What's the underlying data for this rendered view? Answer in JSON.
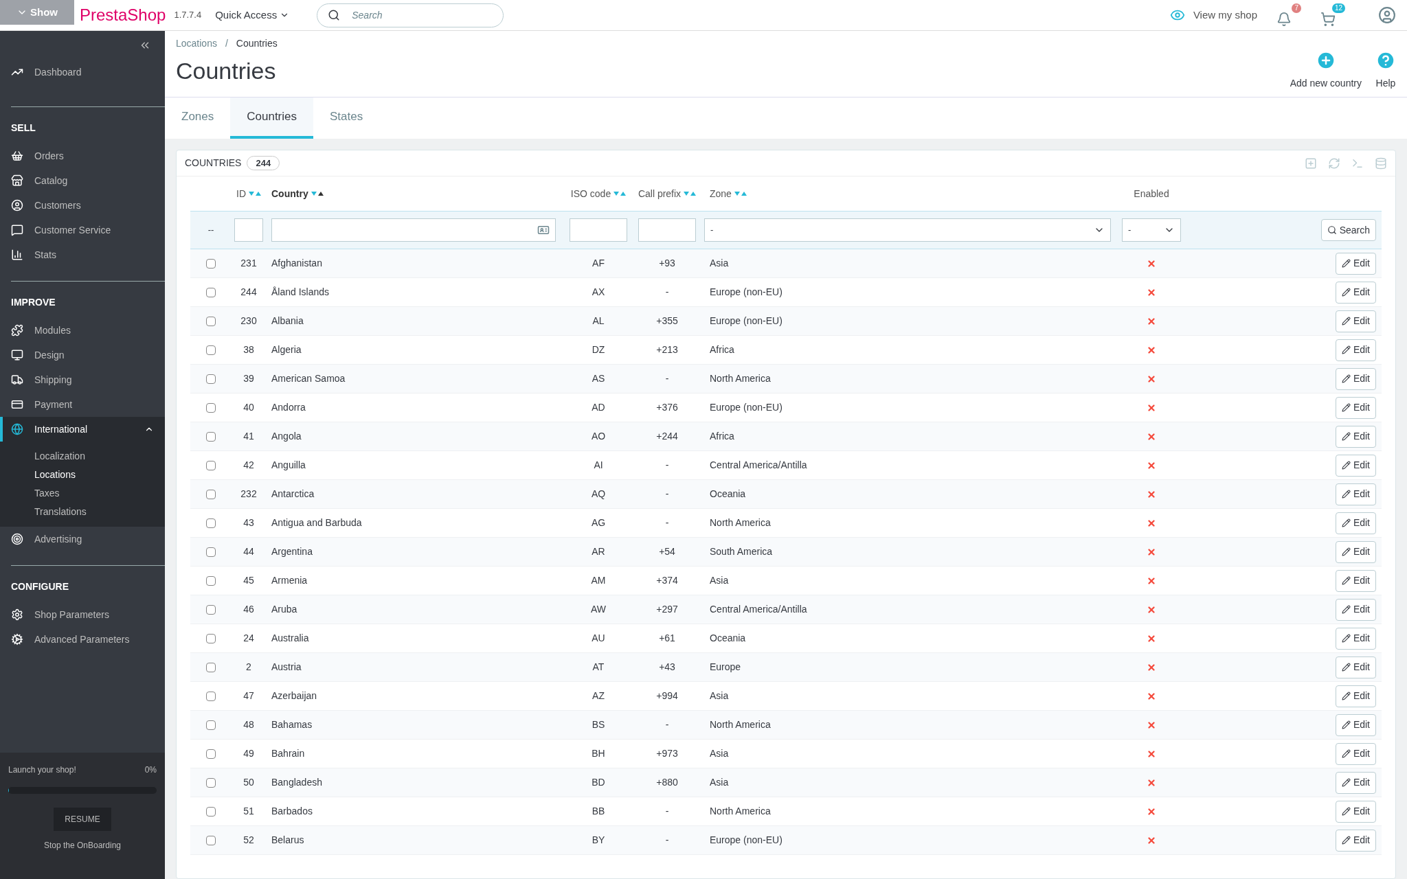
{
  "header": {
    "overlay_button": "Show",
    "logo": "PrestaShop",
    "version": "1.7.7.4",
    "quick_access": "Quick Access",
    "search": {
      "placeholder": "Search"
    },
    "view_shop": "View my shop",
    "notifications": [
      {
        "kind": "bell",
        "count": "7",
        "color": "#e08080"
      },
      {
        "kind": "cart",
        "count": "12",
        "color": "#25b9d7"
      }
    ]
  },
  "sidebar": {
    "sections": [
      {
        "items": [
          {
            "label": "Dashboard",
            "selected": false
          }
        ]
      },
      {
        "title": "SELL",
        "items": [
          {
            "label": "Orders",
            "selected": false
          },
          {
            "label": "Catalog",
            "selected": false
          },
          {
            "label": "Customers",
            "selected": false
          },
          {
            "label": "Customer Service",
            "selected": false
          },
          {
            "label": "Stats",
            "selected": false
          }
        ]
      },
      {
        "title": "IMPROVE",
        "items": [
          {
            "label": "Modules",
            "selected": false
          },
          {
            "label": "Design",
            "selected": false
          },
          {
            "label": "Shipping",
            "selected": false
          },
          {
            "label": "Payment",
            "selected": false
          },
          {
            "label": "International",
            "selected": true,
            "expanded": true,
            "children": [
              {
                "label": "Localization",
                "selected": false
              },
              {
                "label": "Locations",
                "selected": true
              },
              {
                "label": "Taxes",
                "selected": false
              },
              {
                "label": "Translations",
                "selected": false
              }
            ]
          },
          {
            "label": "Advertising",
            "selected": false
          }
        ]
      },
      {
        "title": "CONFIGURE",
        "items": [
          {
            "label": "Shop Parameters",
            "selected": false
          },
          {
            "label": "Advanced Parameters",
            "selected": false
          }
        ]
      }
    ],
    "onboarding": {
      "title": "Launch your shop!",
      "percent": "0%",
      "level": 0,
      "button": "RESUME",
      "stop": "Stop the OnBoarding"
    }
  },
  "breadcrumb": {
    "items": [
      "Locations",
      "Countries"
    ],
    "separator": "/"
  },
  "page_title": "Countries",
  "toolbar": [
    {
      "kind": "add",
      "label": "Add new country"
    },
    {
      "kind": "help",
      "label": "Help"
    }
  ],
  "tabs": [
    {
      "label": "Zones",
      "selected": false
    },
    {
      "label": "Countries",
      "selected": true
    },
    {
      "label": "States",
      "selected": false
    }
  ],
  "panel": {
    "title": "COUNTRIES",
    "count": "244",
    "columns": [
      {
        "label": "ID",
        "sortable": true,
        "sorted": false
      },
      {
        "label": "Country",
        "sortable": true,
        "sorted": true
      },
      {
        "label": "ISO code",
        "sortable": true,
        "sorted": false
      },
      {
        "label": "Call prefix",
        "sortable": true,
        "sorted": false
      },
      {
        "label": "Zone",
        "sortable": true,
        "sorted": false
      },
      {
        "label": "Enabled",
        "sortable": false,
        "sorted": false
      }
    ],
    "filters": {
      "bulk": "--",
      "zone": "-",
      "enabled": "-",
      "search_button": "Search"
    },
    "rows": [
      {
        "id": "231",
        "country": "Afghanistan",
        "iso": "AF",
        "prefix": "+93",
        "zone": "Asia",
        "enabled": false,
        "checked": false,
        "action": "Edit"
      },
      {
        "id": "244",
        "country": "Åland Islands",
        "iso": "AX",
        "prefix": "-",
        "zone": "Europe (non-EU)",
        "enabled": false,
        "checked": false,
        "action": "Edit"
      },
      {
        "id": "230",
        "country": "Albania",
        "iso": "AL",
        "prefix": "+355",
        "zone": "Europe (non-EU)",
        "enabled": false,
        "checked": false,
        "action": "Edit"
      },
      {
        "id": "38",
        "country": "Algeria",
        "iso": "DZ",
        "prefix": "+213",
        "zone": "Africa",
        "enabled": false,
        "checked": false,
        "action": "Edit"
      },
      {
        "id": "39",
        "country": "American Samoa",
        "iso": "AS",
        "prefix": "-",
        "zone": "North America",
        "enabled": false,
        "checked": false,
        "action": "Edit"
      },
      {
        "id": "40",
        "country": "Andorra",
        "iso": "AD",
        "prefix": "+376",
        "zone": "Europe (non-EU)",
        "enabled": false,
        "checked": false,
        "action": "Edit"
      },
      {
        "id": "41",
        "country": "Angola",
        "iso": "AO",
        "prefix": "+244",
        "zone": "Africa",
        "enabled": false,
        "checked": false,
        "action": "Edit"
      },
      {
        "id": "42",
        "country": "Anguilla",
        "iso": "AI",
        "prefix": "-",
        "zone": "Central America/Antilla",
        "enabled": false,
        "checked": false,
        "action": "Edit"
      },
      {
        "id": "232",
        "country": "Antarctica",
        "iso": "AQ",
        "prefix": "-",
        "zone": "Oceania",
        "enabled": false,
        "checked": false,
        "action": "Edit"
      },
      {
        "id": "43",
        "country": "Antigua and Barbuda",
        "iso": "AG",
        "prefix": "-",
        "zone": "North America",
        "enabled": false,
        "checked": false,
        "action": "Edit"
      },
      {
        "id": "44",
        "country": "Argentina",
        "iso": "AR",
        "prefix": "+54",
        "zone": "South America",
        "enabled": false,
        "checked": false,
        "action": "Edit"
      },
      {
        "id": "45",
        "country": "Armenia",
        "iso": "AM",
        "prefix": "+374",
        "zone": "Asia",
        "enabled": false,
        "checked": false,
        "action": "Edit"
      },
      {
        "id": "46",
        "country": "Aruba",
        "iso": "AW",
        "prefix": "+297",
        "zone": "Central America/Antilla",
        "enabled": false,
        "checked": false,
        "action": "Edit"
      },
      {
        "id": "24",
        "country": "Australia",
        "iso": "AU",
        "prefix": "+61",
        "zone": "Oceania",
        "enabled": false,
        "checked": false,
        "action": "Edit"
      },
      {
        "id": "2",
        "country": "Austria",
        "iso": "AT",
        "prefix": "+43",
        "zone": "Europe",
        "enabled": false,
        "checked": false,
        "action": "Edit"
      },
      {
        "id": "47",
        "country": "Azerbaijan",
        "iso": "AZ",
        "prefix": "+994",
        "zone": "Asia",
        "enabled": false,
        "checked": false,
        "action": "Edit"
      },
      {
        "id": "48",
        "country": "Bahamas",
        "iso": "BS",
        "prefix": "-",
        "zone": "North America",
        "enabled": false,
        "checked": false,
        "action": "Edit"
      },
      {
        "id": "49",
        "country": "Bahrain",
        "iso": "BH",
        "prefix": "+973",
        "zone": "Asia",
        "enabled": false,
        "checked": false,
        "action": "Edit"
      },
      {
        "id": "50",
        "country": "Bangladesh",
        "iso": "BD",
        "prefix": "+880",
        "zone": "Asia",
        "enabled": false,
        "checked": false,
        "action": "Edit"
      },
      {
        "id": "51",
        "country": "Barbados",
        "iso": "BB",
        "prefix": "-",
        "zone": "North America",
        "enabled": false,
        "checked": false,
        "action": "Edit"
      },
      {
        "id": "52",
        "country": "Belarus",
        "iso": "BY",
        "prefix": "-",
        "zone": "Europe (non-EU)",
        "enabled": false,
        "checked": false,
        "action": "Edit"
      }
    ]
  }
}
